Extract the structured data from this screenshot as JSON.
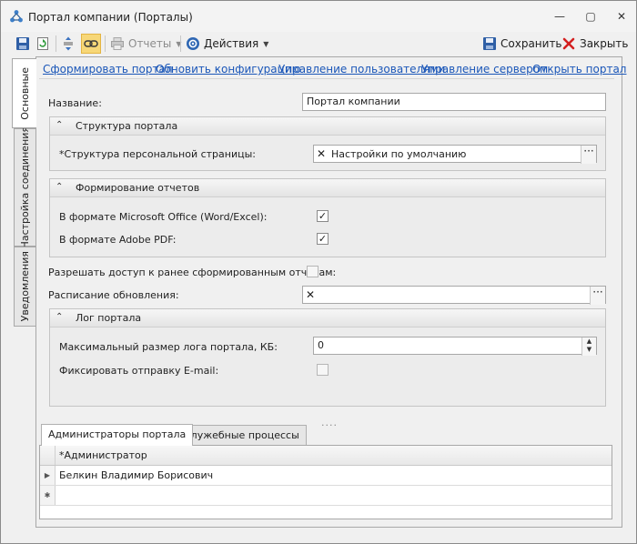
{
  "window": {
    "title": "Портал компании (Порталы)",
    "controls": {
      "minimize": "—",
      "maximize": "▢",
      "close": "✕"
    }
  },
  "toolbar": {
    "reports_label": "Отчеты",
    "actions_label": "Действия",
    "save_label": "Сохранить",
    "close_label": "Закрыть"
  },
  "side_tabs": [
    {
      "label": "Основные",
      "active": true
    },
    {
      "label": "Настройка соединения",
      "active": false
    },
    {
      "label": "Уведомления",
      "active": false
    }
  ],
  "links": [
    "Сформировать портал",
    "Обновить конфигурацию",
    "Управление пользователями",
    "Управление сервером",
    "Открыть портал"
  ],
  "form": {
    "name_label": "Название:",
    "name_value": "Портал компании",
    "group_structure": {
      "title": "Структура портала",
      "personal_page_label": "*Структура персональной страницы:",
      "personal_page_value": "Настройки по умолчанию"
    },
    "group_reports": {
      "title": "Формирование отчетов",
      "office_label": "В формате Microsoft Office (Word/Excel):",
      "office_checked": true,
      "pdf_label": "В формате Adobe PDF:",
      "pdf_checked": true
    },
    "allow_access_label": "Разрешать доступ к ранее сформированным отчетам:",
    "allow_access_checked": false,
    "schedule_label": "Расписание обновления:",
    "schedule_value": "",
    "group_log": {
      "title": "Лог портала",
      "max_size_label": "Максимальный размер лога портала, КБ:",
      "max_size_value": "0",
      "email_label": "Фиксировать отправку E-mail:",
      "email_checked": false
    },
    "splitter": "....",
    "bottom_tabs": [
      "Администраторы портала",
      "Служебные процессы"
    ],
    "grid": {
      "column": "*Администратор",
      "rows": [
        "Белкин Владимир Борисович"
      ],
      "new_row_marker": "✱"
    }
  },
  "glyphs": {
    "clear": "✕",
    "ellipsis": "···",
    "check": "✓",
    "chevron_up": "⌃",
    "caret": "▼",
    "row_arrow": "▶"
  },
  "colors": {
    "link": "#1a56b8",
    "accent_close": "#d42020",
    "pressed": "#f7d778"
  }
}
